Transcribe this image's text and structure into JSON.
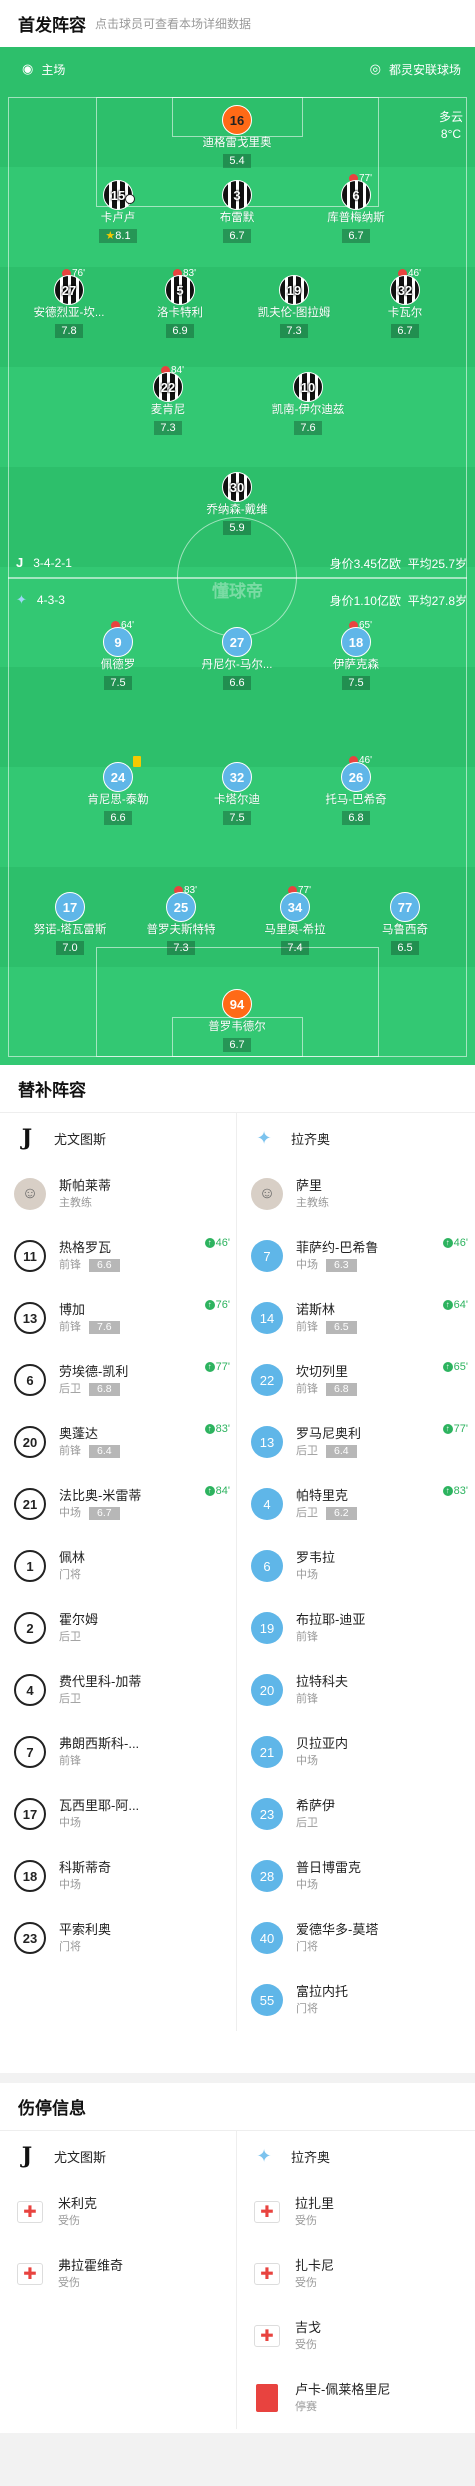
{
  "header": {
    "title": "首发阵容",
    "subtitle": "点击球员可查看本场详细数据"
  },
  "pitch": {
    "home_label": "主场",
    "stadium": "都灵安联球场",
    "weather": "多云",
    "temp": "8°C",
    "watermark": "懂球帝",
    "juve_formation": "3-4-2-1",
    "juve_value": "身价3.45亿欧",
    "juve_age": "平均25.7岁",
    "lazio_formation": "4-3-3",
    "lazio_value": "身价1.10亿欧",
    "lazio_age": "平均27.8岁",
    "juve_players": [
      {
        "num": "16",
        "name": "迪格雷戈里奥",
        "rating": "5.4"
      },
      {
        "num": "15",
        "name": "卡卢卢",
        "rating": "8.1"
      },
      {
        "num": "3",
        "name": "布雷默",
        "rating": "6.7"
      },
      {
        "num": "6",
        "name": "库普梅纳斯",
        "rating": "6.7",
        "event": "77'"
      },
      {
        "num": "27",
        "name": "安德烈亚-坎...",
        "rating": "7.8",
        "event": "76'"
      },
      {
        "num": "5",
        "name": "洛卡特利",
        "rating": "6.9",
        "event": "83'"
      },
      {
        "num": "19",
        "name": "凯夫伦-图拉姆",
        "rating": "7.3"
      },
      {
        "num": "32",
        "name": "卡瓦尔",
        "rating": "6.7",
        "event": "46'"
      },
      {
        "num": "22",
        "name": "麦肯尼",
        "rating": "7.3",
        "event": "84'"
      },
      {
        "num": "10",
        "name": "凯南-伊尔迪兹",
        "rating": "7.6"
      },
      {
        "num": "30",
        "name": "乔纳森-戴维",
        "rating": "5.9"
      }
    ],
    "lazio_players": [
      {
        "num": "9",
        "name": "佩德罗",
        "rating": "7.5",
        "event": "64'"
      },
      {
        "num": "27",
        "name": "丹尼尔-马尔...",
        "rating": "6.6"
      },
      {
        "num": "18",
        "name": "伊萨克森",
        "rating": "7.5",
        "event": "65'"
      },
      {
        "num": "24",
        "name": "肯尼思-泰勒",
        "rating": "6.6"
      },
      {
        "num": "32",
        "name": "卡塔尔迪",
        "rating": "7.5"
      },
      {
        "num": "26",
        "name": "托马-巴希奇",
        "rating": "6.8",
        "event": "46'"
      },
      {
        "num": "17",
        "name": "努诺-塔瓦雷斯",
        "rating": "7.0"
      },
      {
        "num": "25",
        "name": "普罗夫斯特特",
        "rating": "7.3",
        "event": "83'"
      },
      {
        "num": "34",
        "name": "马里奥-希拉",
        "rating": "7.4",
        "event": "77'"
      },
      {
        "num": "77",
        "name": "马鲁西奇",
        "rating": "6.5"
      },
      {
        "num": "94",
        "name": "普罗韦德尔",
        "rating": "6.7"
      }
    ]
  },
  "subs": {
    "title": "替补阵容",
    "juve_team": "尤文图斯",
    "lazio_team": "拉齐奥",
    "juve_coach": {
      "name": "斯帕莱蒂",
      "role": "主教练"
    },
    "lazio_coach": {
      "name": "萨里",
      "role": "主教练"
    },
    "juve": [
      {
        "num": "11",
        "name": "热格罗瓦",
        "pos": "前锋",
        "rating": "6.6",
        "event": "46'"
      },
      {
        "num": "13",
        "name": "博加",
        "pos": "前锋",
        "rating": "7.6",
        "event": "76'"
      },
      {
        "num": "6",
        "name": "劳埃德-凯利",
        "pos": "后卫",
        "rating": "6.8",
        "event": "77'"
      },
      {
        "num": "20",
        "name": "奥蓬达",
        "pos": "前锋",
        "rating": "6.4",
        "event": "83'"
      },
      {
        "num": "21",
        "name": "法比奥-米雷蒂",
        "pos": "中场",
        "rating": "6.7",
        "event": "84'"
      },
      {
        "num": "1",
        "name": "佩林",
        "pos": "门将"
      },
      {
        "num": "2",
        "name": "霍尔姆",
        "pos": "后卫"
      },
      {
        "num": "4",
        "name": "费代里科-加蒂",
        "pos": "后卫"
      },
      {
        "num": "7",
        "name": "弗朗西斯科-...",
        "pos": "前锋"
      },
      {
        "num": "17",
        "name": "瓦西里耶-阿...",
        "pos": "中场"
      },
      {
        "num": "18",
        "name": "科斯蒂奇",
        "pos": "中场"
      },
      {
        "num": "23",
        "name": "平索利奥",
        "pos": "门将"
      }
    ],
    "lazio": [
      {
        "num": "7",
        "name": "菲萨约-巴希鲁",
        "pos": "中场",
        "rating": "6.3",
        "event": "46'"
      },
      {
        "num": "14",
        "name": "诺斯林",
        "pos": "前锋",
        "rating": "6.5",
        "event": "64'"
      },
      {
        "num": "22",
        "name": "坎切列里",
        "pos": "前锋",
        "rating": "6.8",
        "event": "65'"
      },
      {
        "num": "13",
        "name": "罗马尼奥利",
        "pos": "后卫",
        "rating": "6.4",
        "event": "77'"
      },
      {
        "num": "4",
        "name": "帕特里克",
        "pos": "后卫",
        "rating": "6.2",
        "event": "83'"
      },
      {
        "num": "6",
        "name": "罗韦拉",
        "pos": "中场"
      },
      {
        "num": "19",
        "name": "布拉耶-迪亚",
        "pos": "前锋"
      },
      {
        "num": "20",
        "name": "拉特科夫",
        "pos": "前锋"
      },
      {
        "num": "21",
        "name": "贝拉亚内",
        "pos": "中场"
      },
      {
        "num": "23",
        "name": "希萨伊",
        "pos": "后卫"
      },
      {
        "num": "28",
        "name": "普日博雷克",
        "pos": "中场"
      },
      {
        "num": "40",
        "name": "爱德华多-莫塔",
        "pos": "门将"
      },
      {
        "num": "55",
        "name": "富拉内托",
        "pos": "门将"
      }
    ]
  },
  "injuries": {
    "title": "伤停信息",
    "juve_team": "尤文图斯",
    "lazio_team": "拉齐奥",
    "juve": [
      {
        "name": "米利克",
        "status": "受伤"
      },
      {
        "name": "弗拉霍维奇",
        "status": "受伤"
      }
    ],
    "lazio": [
      {
        "name": "拉扎里",
        "status": "受伤"
      },
      {
        "name": "扎卡尼",
        "status": "受伤"
      },
      {
        "name": "吉戈",
        "status": "受伤"
      },
      {
        "name": "卢卡-佩莱格里尼",
        "status": "停赛"
      }
    ]
  }
}
